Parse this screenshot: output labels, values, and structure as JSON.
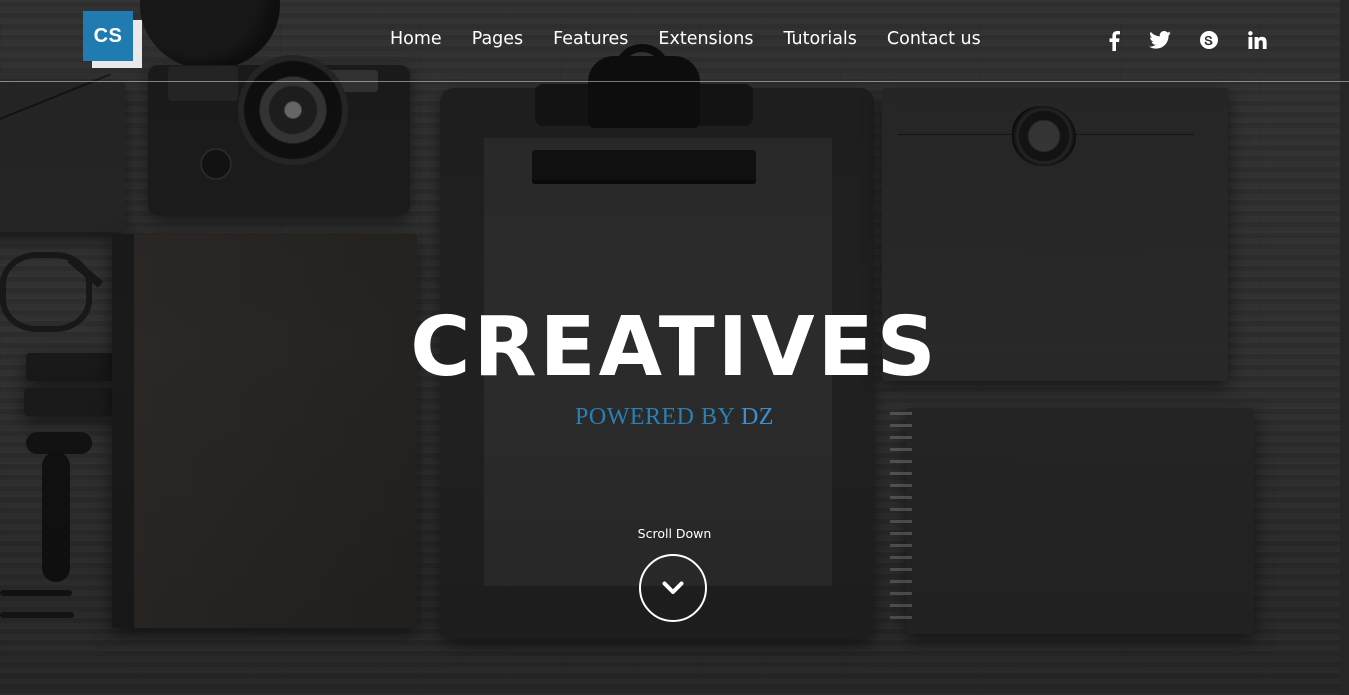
{
  "header": {
    "logo_text": "CS",
    "nav": [
      {
        "label": "Home"
      },
      {
        "label": "Pages"
      },
      {
        "label": "Features"
      },
      {
        "label": "Extensions"
      },
      {
        "label": "Tutorials"
      },
      {
        "label": "Contact us"
      }
    ],
    "social_icons": [
      "facebook-icon",
      "twitter-icon",
      "skype-icon",
      "linkedin-icon"
    ]
  },
  "hero": {
    "title": "CREATIVES",
    "subtitle_prefix": "POWERED BY ",
    "subtitle_brand": "DZ",
    "scroll_label": "Scroll Down",
    "scroll_icon": "chevron-down-icon"
  },
  "colors": {
    "logo_bg": "#1f7bb0",
    "subtitle": "#2a7fb3",
    "subtitle_brand": "#3d8fd1",
    "text": "#ffffff"
  }
}
